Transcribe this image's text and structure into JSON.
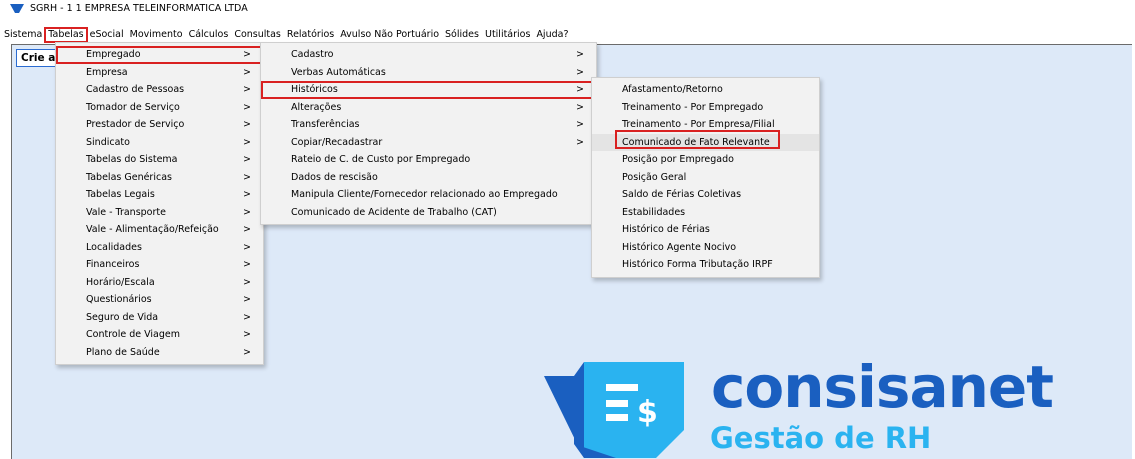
{
  "window": {
    "title": "SGRH - 1 1 EMPRESA TELEINFORMATICA LTDA"
  },
  "menubar": [
    "Sistema",
    "Tabelas",
    "eSocial",
    "Movimento",
    "Cálculos",
    "Consultas",
    "Relatórios",
    "Avulso Não Portuário",
    "Sólides",
    "Utilitários",
    "Ajuda?"
  ],
  "client": {
    "crie_label": "Crie a"
  },
  "menu1": [
    {
      "label": "Empregado",
      "arrow": ">"
    },
    {
      "label": "Empresa",
      "arrow": ">"
    },
    {
      "label": "Cadastro de Pessoas",
      "arrow": ">"
    },
    {
      "label": "Tomador de Serviço",
      "arrow": ">"
    },
    {
      "label": "Prestador de Serviço",
      "arrow": ">"
    },
    {
      "label": "Sindicato",
      "arrow": ">"
    },
    {
      "label": "Tabelas do Sistema",
      "arrow": ">"
    },
    {
      "label": "Tabelas Genéricas",
      "arrow": ">"
    },
    {
      "label": "Tabelas Legais",
      "arrow": ">"
    },
    {
      "label": "Vale - Transporte",
      "arrow": ">"
    },
    {
      "label": "Vale - Alimentação/Refeição",
      "arrow": ">"
    },
    {
      "label": "Localidades",
      "arrow": ">"
    },
    {
      "label": "Financeiros",
      "arrow": ">"
    },
    {
      "label": "Horário/Escala",
      "arrow": ">"
    },
    {
      "label": "Questionários",
      "arrow": ">"
    },
    {
      "label": "Seguro de Vida",
      "arrow": ">"
    },
    {
      "label": "Controle de Viagem",
      "arrow": ">"
    },
    {
      "label": "Plano de Saúde",
      "arrow": ">"
    }
  ],
  "menu2": [
    {
      "label": "Cadastro",
      "arrow": ">"
    },
    {
      "label": "Verbas Automáticas",
      "arrow": ">"
    },
    {
      "label": "Históricos",
      "arrow": ">"
    },
    {
      "label": "Alterações",
      "arrow": ">"
    },
    {
      "label": "Transferências",
      "arrow": ">"
    },
    {
      "label": "Copiar/Recadastrar",
      "arrow": ">"
    },
    {
      "label": "Rateio de C. de Custo por Empregado",
      "arrow": ""
    },
    {
      "label": "Dados de rescisão",
      "arrow": ""
    },
    {
      "label": "Manipula Cliente/Fornecedor relacionado ao Empregado",
      "arrow": ""
    },
    {
      "label": "Comunicado de Acidente de Trabalho (CAT)",
      "arrow": ""
    }
  ],
  "menu3": [
    {
      "label": "Afastamento/Retorno"
    },
    {
      "label": "Treinamento - Por Empregado"
    },
    {
      "label": "Treinamento - Por Empresa/Filial"
    },
    {
      "label": "Comunicado de Fato Relevante"
    },
    {
      "label": "Posição por Empregado"
    },
    {
      "label": "Posição Geral"
    },
    {
      "label": "Saldo de Férias Coletivas"
    },
    {
      "label": "Estabilidades"
    },
    {
      "label": "Histórico de Férias"
    },
    {
      "label": "Histórico Agente Nocivo"
    },
    {
      "label": "Histórico Forma Tributação IRPF"
    }
  ],
  "logo": {
    "brand": "consisanet",
    "subtitle": "Gestão de RH"
  },
  "colors": {
    "highlight": "#d92121",
    "workspace": "#dde9f8",
    "brand": "#1a5fc0",
    "brand_light": "#2ab3f0"
  }
}
